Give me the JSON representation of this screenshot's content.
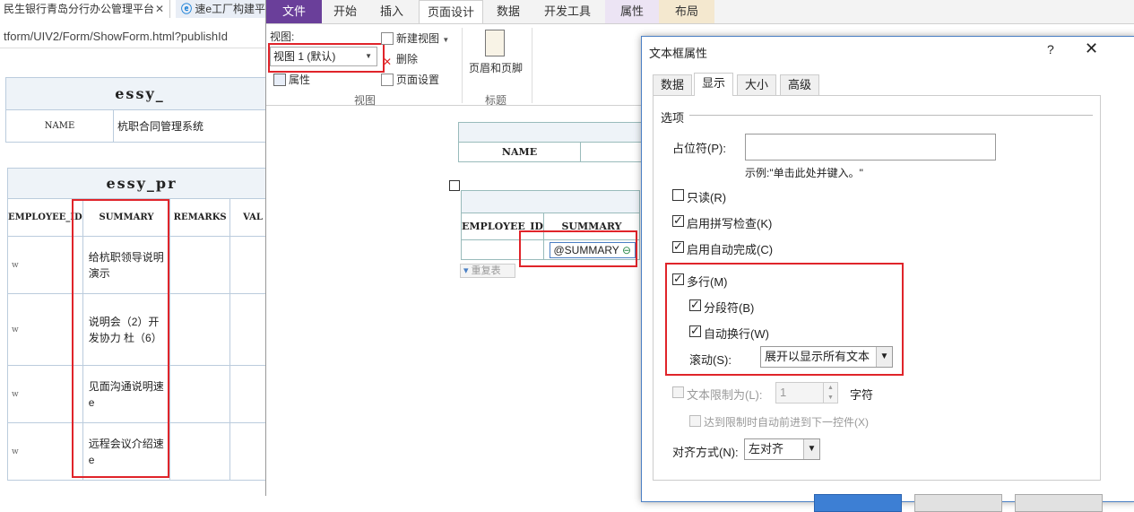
{
  "browser": {
    "tabs": [
      "民生银行青岛分行办公管理平台",
      "速e工厂构建平台"
    ],
    "url": "tform/UIV2/Form/ShowForm.html?publishId",
    "form1": {
      "title": "essy_",
      "name_label": "NAME",
      "name_value": "杭职合同管理系统"
    },
    "form2": {
      "title": "essy_pr",
      "headers": [
        "EMPLOYEE_ID",
        "SUMMARY",
        "REMARKS",
        "VAL"
      ],
      "rows": [
        {
          "id": "w",
          "summary": "给杭职领导说明演示"
        },
        {
          "id": "w",
          "summary": "说明会（2）开发协力 杜（6）"
        },
        {
          "id": "w",
          "summary": "见面沟通说明速e"
        },
        {
          "id": "w",
          "summary": "远程会议介绍速e"
        }
      ]
    }
  },
  "ribbon": {
    "tabs": [
      "文件",
      "开始",
      "插入",
      "页面设计",
      "数据",
      "开发工具",
      "属性",
      "布局"
    ],
    "view_label": "视图:",
    "view_select": "视图 1 (默认)",
    "properties": "属性",
    "new_view": "新建视图",
    "delete": "删除",
    "page_setup": "页面设置",
    "group_view": "视图",
    "header_footer": "页眉和页脚",
    "group_title": "标题"
  },
  "canvas": {
    "name_label": "NAME",
    "employee_id": "EMPLOYEE_ID",
    "summary_header": "SUMMARY",
    "summary_field": "@SUMMARY",
    "repeat_table": "重复表"
  },
  "dialog": {
    "title": "文本框属性",
    "help": "?",
    "tabs": [
      "数据",
      "显示",
      "大小",
      "高级"
    ],
    "section": "选项",
    "placeholder_label": "占位符(P):",
    "placeholder_value": "",
    "example": "示例:\"单击此处并键入。\"",
    "readonly": "只读(R)",
    "spellcheck": "启用拼写检查(K)",
    "autocomplete": "启用自动完成(C)",
    "multiline": "多行(M)",
    "paragraph": "分段符(B)",
    "wrap": "自动换行(W)",
    "scroll_label": "滚动(S):",
    "scroll_value": "展开以显示所有文本",
    "limit_label": "文本限制为(L):",
    "limit_value": "1",
    "limit_unit": "字符",
    "advance": "达到限制时自动前进到下一控件(X)",
    "align_label": "对齐方式(N):",
    "align_value": "左对齐"
  }
}
